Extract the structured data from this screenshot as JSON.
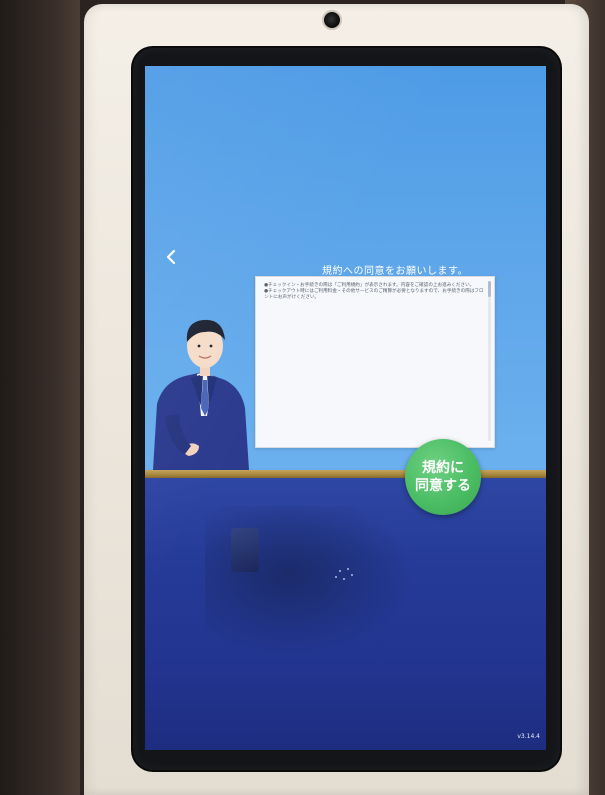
{
  "screen": {
    "title": "規約への同意をお願いします。",
    "terms_lines": [
      "●チェックイン・お手続きの際は「ご利用規約」が表示されます。内容をご確認の上お進みください。",
      "●チェックアウト時にはご利用料金・その他サービスのご精算が必要となりますので、お手続きの際はフロントにお声がけください。"
    ],
    "agree_button": {
      "line1": "規約に",
      "line2": "同意する"
    },
    "back_icon": "chevron-left-icon",
    "version": "v3.14.4"
  },
  "colors": {
    "screen_top": "#4e9be6",
    "screen_bottom": "#1d2d80",
    "accent_gold": "#b08f43",
    "agree_green": "#4bbd63"
  }
}
